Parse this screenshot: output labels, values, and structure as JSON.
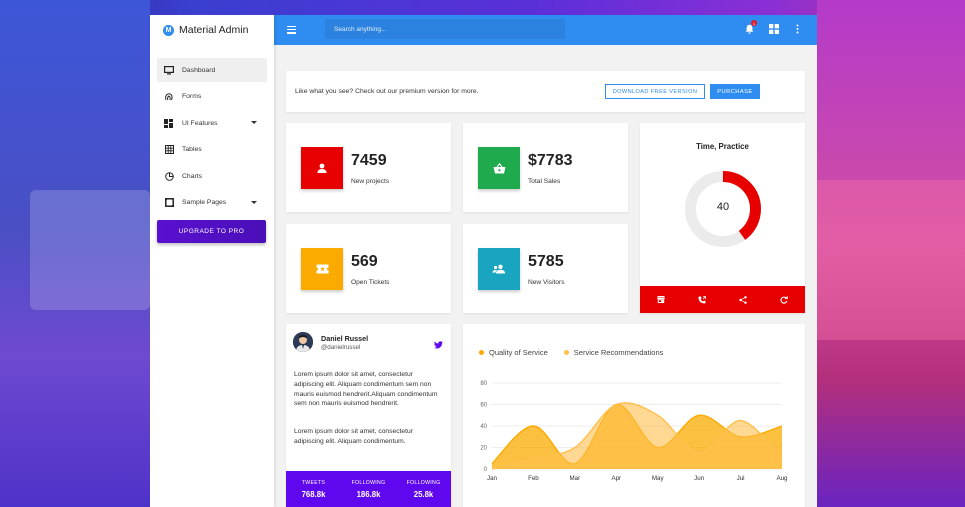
{
  "brand": {
    "name": "Material Admin",
    "logo_letter": "M"
  },
  "sidebar": {
    "items": [
      {
        "label": "Dashboard",
        "icon": "monitor-icon",
        "active": true
      },
      {
        "label": "Forms",
        "icon": "fingerprint-icon"
      },
      {
        "label": "UI Features",
        "icon": "dashboard-grid-icon",
        "caret": true
      },
      {
        "label": "Tables",
        "icon": "table-icon"
      },
      {
        "label": "Charts",
        "icon": "pie-chart-icon"
      },
      {
        "label": "Sample Pages",
        "icon": "crop-square-icon",
        "caret": true
      }
    ],
    "upgrade_label": "UPGRADE TO PRO"
  },
  "topbar": {
    "search_placeholder": "Search anything...",
    "notification_count": "1",
    "icons": [
      "menu-icon",
      "bell-icon",
      "apps-icon",
      "more-vert-icon"
    ]
  },
  "promo": {
    "text": "Like what you see? Check out our premium version for more.",
    "download_label": "DOWNLOAD FREE VERSION",
    "purchase_label": "PURCHASE"
  },
  "stats": [
    {
      "value": "7459",
      "label": "New projects",
      "color": "#e60000",
      "icon": "person-icon"
    },
    {
      "value": "$7783",
      "label": "Total Sales",
      "color": "#1eaa4d",
      "icon": "basket-icon"
    },
    {
      "value": "569",
      "label": "Open Tickets",
      "color": "#fbab00",
      "icon": "ticket-icon"
    },
    {
      "value": "5785",
      "label": "New Visitors",
      "color": "#19a4c0",
      "icon": "group-icon"
    }
  ],
  "time_card": {
    "title": "Time, Practice",
    "value": "40",
    "progress": 0.4,
    "ring_color": "#e60000",
    "track_color": "#ebebeb",
    "actions": [
      "store-icon",
      "phone-icon",
      "share-icon",
      "refresh-icon"
    ]
  },
  "profile": {
    "name": "Daniel Russel",
    "handle": "@danielrussel",
    "paragraph1": "Lorem ipsum dolor sit amet, consectetur adipiscing elit. Aliquam condimentum sem non mauris euismod hendrerit.Aliquam condimentum sem non mauris euismod hendrerit.",
    "paragraph2": "Lorem ipsum dolor sit amet, consectetur adipiscing elit. Aliquam condimentum.",
    "stats": [
      {
        "label": "TWEETS",
        "value": "768.8k"
      },
      {
        "label": "FOLLOWING",
        "value": "186.8k"
      },
      {
        "label": "FOLLOWING",
        "value": "25.8k"
      }
    ]
  },
  "chart_data": {
    "type": "area",
    "categories": [
      "Jan",
      "Feb",
      "Mar",
      "Apr",
      "May",
      "Jun",
      "Jul",
      "Aug"
    ],
    "ylim": [
      0,
      80
    ],
    "yticks": [
      0,
      20,
      40,
      60,
      80
    ],
    "series": [
      {
        "name": "Quality of Service",
        "color": "#fbab00",
        "values": [
          5,
          40,
          5,
          60,
          20,
          50,
          30,
          40
        ]
      },
      {
        "name": "Service Recommendations",
        "color": "#ffc04d",
        "values": [
          0,
          10,
          20,
          60,
          50,
          15,
          45,
          10
        ]
      }
    ]
  }
}
